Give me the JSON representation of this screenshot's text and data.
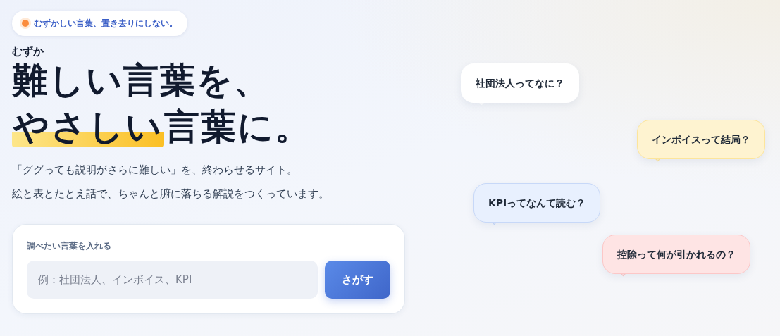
{
  "tagline": {
    "text": "むずかしい言葉、置き去りにしない。"
  },
  "headline": {
    "ruby": "むずか",
    "line1": "難しい言葉を、",
    "line2_highlight": "やさしい",
    "line2_rest": "言葉に。"
  },
  "lead": [
    "「ググっても説明がさらに難しい」を、終わらせるサイト。",
    "絵と表とたとえ話で、ちゃんと腑に落ちる解説をつくっています。"
  ],
  "search": {
    "label": "調べたい言葉を入れる",
    "placeholder": "例：社団法人、インボイス、KPI",
    "button": "さがす"
  },
  "bubbles": [
    {
      "text": "社団法人ってなに？",
      "color": "#ffffff"
    },
    {
      "text": "インボイスって結局？",
      "color": "#fef3d0"
    },
    {
      "text": "KPIってなんて読む？",
      "color": "#e8f0fe"
    },
    {
      "text": "控除って何が引かれるの？",
      "color": "#fee4e4"
    }
  ]
}
